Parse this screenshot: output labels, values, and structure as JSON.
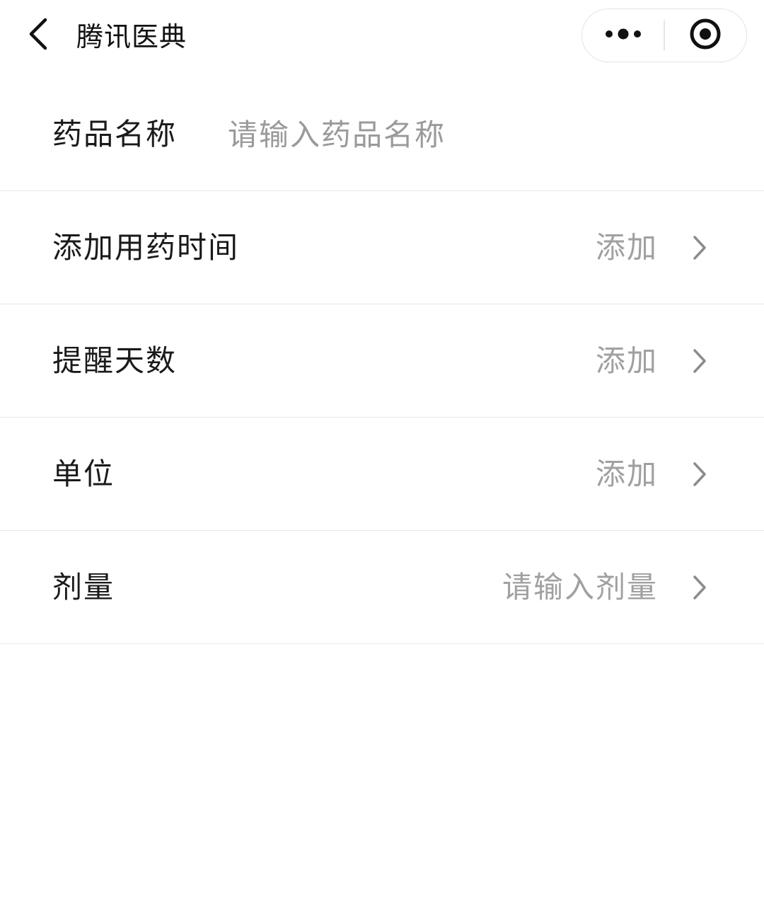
{
  "navbar": {
    "title": "腾讯医典",
    "back_icon": "chevron-left-icon",
    "more_icon": "more-dots-icon",
    "close_icon": "target-circle-icon"
  },
  "form": {
    "drug_name": {
      "label": "药品名称",
      "placeholder": "请输入药品名称",
      "value": ""
    },
    "rows": [
      {
        "label": "添加用药时间",
        "value": "添加"
      },
      {
        "label": "提醒天数",
        "value": "添加"
      },
      {
        "label": "单位",
        "value": "添加"
      },
      {
        "label": "剂量",
        "value": "请输入剂量"
      }
    ]
  },
  "colors": {
    "background": "#ffffff",
    "text_primary": "#1a1a1a",
    "text_placeholder": "#a0a0a0",
    "divider": "#e8e8e8"
  }
}
